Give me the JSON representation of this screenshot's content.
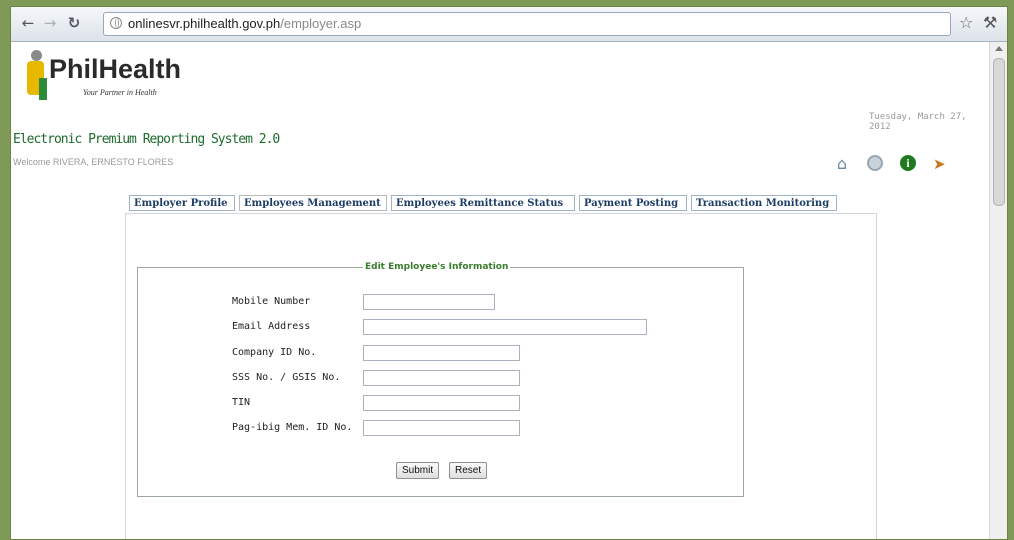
{
  "browser": {
    "url_host": "onlinesvr.philhealth.gov.ph",
    "url_path": "/employer.asp",
    "back_icon": "arrow-left-icon",
    "forward_icon": "arrow-right-icon",
    "reload_icon": "reload-icon",
    "bookmark_icon": "star-icon",
    "settings_icon": "wrench-icon"
  },
  "header": {
    "brand": "PhilHealth",
    "tagline": "Your Partner in Health",
    "date": "Tuesday, March 27, 2012",
    "system_title": "Electronic Premium Reporting System 2.0",
    "welcome": "Welcome RIVERA, ERNESTO FLORES",
    "icons": [
      "home-icon",
      "settings-icon",
      "info-icon",
      "logout-icon"
    ]
  },
  "tabs": [
    {
      "label": "Employer Profile"
    },
    {
      "label": "Employees Management"
    },
    {
      "label": "Employees Remittance Status"
    },
    {
      "label": "Payment Posting"
    },
    {
      "label": "Transaction Monitoring"
    }
  ],
  "form": {
    "legend": "Edit Employee's Information",
    "fields": [
      {
        "label": "Mobile Number",
        "value": ""
      },
      {
        "label": "Email Address",
        "value": ""
      },
      {
        "label": "Company ID No.",
        "value": ""
      },
      {
        "label": "SSS No. / GSIS No.",
        "value": ""
      },
      {
        "label": "TIN",
        "value": ""
      },
      {
        "label": "Pag-ibig Mem. ID No.",
        "value": ""
      }
    ],
    "submit_label": "Submit",
    "reset_label": "Reset"
  },
  "colors": {
    "frame_bg": "#7e9a56",
    "title_green": "#1e6b2e",
    "tab_text": "#1c3d66",
    "legend_green": "#3a7d2e"
  }
}
